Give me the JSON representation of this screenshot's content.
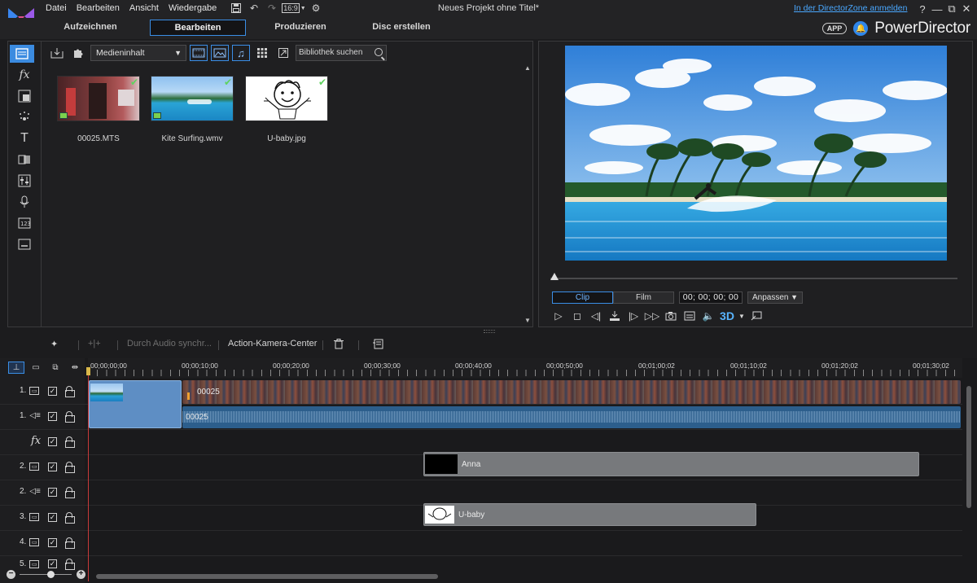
{
  "menu": {
    "items": [
      "Datei",
      "Bearbeiten",
      "Ansicht",
      "Wiedergabe"
    ],
    "icons": [
      "save-icon",
      "undo-icon",
      "redo-icon",
      "aspect-ratio-icon",
      "settings-gear-icon"
    ],
    "aspect_ratio": "16:9",
    "project_title": "Neues Projekt ohne Titel*",
    "directorzone_link": "In der DirectorZone anmelden",
    "window_controls": [
      "?",
      "—",
      "⧉",
      "✕"
    ]
  },
  "modes": {
    "tabs": [
      "Aufzeichnen",
      "Bearbeiten",
      "Produzieren",
      "Disc erstellen"
    ],
    "active": "Bearbeiten"
  },
  "brand": {
    "app_badge": "APP",
    "name": "PowerDirector"
  },
  "rooms": [
    "media-room-icon",
    "fx-room-icon",
    "pip-room-icon",
    "particle-room-icon",
    "title-room-icon",
    "transition-room-icon",
    "audio-mixing-room-icon",
    "voiceover-room-icon",
    "chapter-room-icon",
    "subtitle-room-icon"
  ],
  "library": {
    "filter": "Medieninhalt",
    "search_placeholder": "Bibliothek suchen",
    "items": [
      {
        "name": "00025.MTS",
        "type": "video"
      },
      {
        "name": "Kite Surfing.wmv",
        "type": "video"
      },
      {
        "name": "U-baby.jpg",
        "type": "image"
      }
    ]
  },
  "preview": {
    "clip_label": "Clip",
    "film_label": "Film",
    "timecode": "00; 00; 00; 00",
    "fit_label": "Anpassen",
    "three_d": "3D",
    "position": 0
  },
  "timeline_toolbar": {
    "audio_sync": "Durch Audio synchr...",
    "action_cam": "Action-Kamera-Center"
  },
  "ruler": {
    "ticks": [
      "00;00;00;00",
      "00;00;10;00",
      "00;00;20;00",
      "00;00;30;00",
      "00;00;40;00",
      "00;00;50;00",
      "00;01;00;02",
      "00;01;10;02",
      "00;01;20;02",
      "00;01;30;02"
    ]
  },
  "tracks": [
    {
      "label": "1.",
      "kind": "video"
    },
    {
      "label": "1.",
      "kind": "audio"
    },
    {
      "label": "",
      "kind": "fx"
    },
    {
      "label": "2.",
      "kind": "video"
    },
    {
      "label": "2.",
      "kind": "audio"
    },
    {
      "label": "3.",
      "kind": "video"
    },
    {
      "label": "4.",
      "kind": "video"
    },
    {
      "label": "5.",
      "kind": "video"
    }
  ],
  "clips": {
    "track1_video_name": "00025",
    "track1_audio_name": "00025",
    "track2_title": "Anna",
    "track3_image": "U-baby"
  }
}
